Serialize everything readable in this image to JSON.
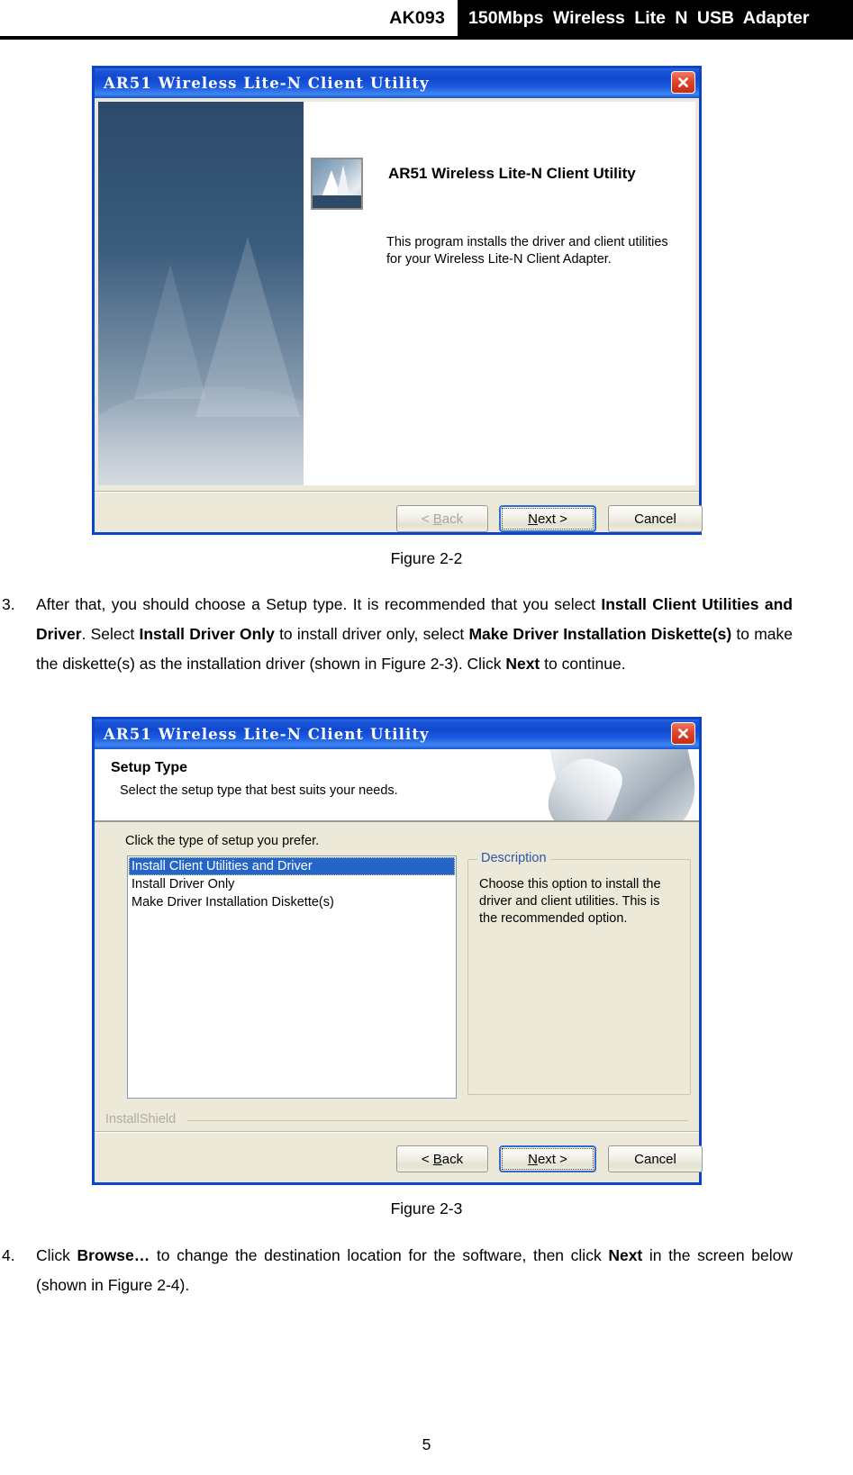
{
  "header": {
    "model": "AK093",
    "product": "150Mbps  Wireless  Lite  N  USB  Adapter"
  },
  "figure_2_2": {
    "titlebar": "AR51 Wireless Lite-N Client Utility",
    "close_icon": "close-icon",
    "splash_title": "AR51 Wireless Lite-N Client Utility",
    "splash_description": "This program installs the driver and client utilities for your Wireless Lite-N Client Adapter.",
    "buttons": {
      "back": "< Back",
      "back_prefix": "< ",
      "back_underline": "B",
      "back_rest": "ack",
      "next_prefix": "",
      "next_underline": "N",
      "next_rest": "ext >",
      "cancel": "Cancel"
    },
    "caption": "Figure 2-2"
  },
  "paragraph_3": {
    "number": "3.",
    "segments": [
      {
        "text": "After that, you should choose a Setup type. It is recommended that you select ",
        "bold": false
      },
      {
        "text": "Install Client Utilities and Driver",
        "bold": true
      },
      {
        "text": ". Select ",
        "bold": false
      },
      {
        "text": "Install Driver Only",
        "bold": true
      },
      {
        "text": " to install driver only, select ",
        "bold": false
      },
      {
        "text": "Make Driver Installation Diskette(s)",
        "bold": true
      },
      {
        "text": " to make the diskette(s) as the installation driver (shown in Figure 2-3). Click ",
        "bold": false
      },
      {
        "text": "Next",
        "bold": true
      },
      {
        "text": " to continue.",
        "bold": false
      }
    ]
  },
  "figure_2_3": {
    "titlebar": "AR51 Wireless Lite-N Client Utility",
    "close_icon": "close-icon",
    "banner_title": "Setup Type",
    "banner_subtitle": "Select the setup type that best suits your needs.",
    "prompt": "Click the type of setup you prefer.",
    "setup_options": [
      {
        "label": "Install Client Utilities and Driver",
        "selected": true
      },
      {
        "label": "Install Driver Only",
        "selected": false
      },
      {
        "label": "Make Driver Installation Diskette(s)",
        "selected": false
      }
    ],
    "description_legend": "Description",
    "description_text": "Choose this option to install the driver and client utilities. This is the recommended option.",
    "installshield": "InstallShield",
    "buttons": {
      "back_prefix": "< ",
      "back_underline": "B",
      "back_rest": "ack",
      "next_underline": "N",
      "next_rest": "ext >",
      "cancel": "Cancel"
    },
    "caption": "Figure 2-3"
  },
  "paragraph_4": {
    "number": "4.",
    "segments": [
      {
        "text": "Click ",
        "bold": false
      },
      {
        "text": "Browse…",
        "bold": true
      },
      {
        "text": " to change the destination location for the software, then click ",
        "bold": false
      },
      {
        "text": "Next",
        "bold": true
      },
      {
        "text": " in the screen below (shown in Figure 2-4).",
        "bold": false
      }
    ]
  },
  "page_number": "5",
  "colors": {
    "titlebar_blue": "#1049cf",
    "dialog_border": "#0b46c8",
    "dialog_face": "#ece9d8",
    "selection_blue": "#2565c8",
    "legend_blue": "#2d55a8",
    "close_red": "#c72c14"
  }
}
